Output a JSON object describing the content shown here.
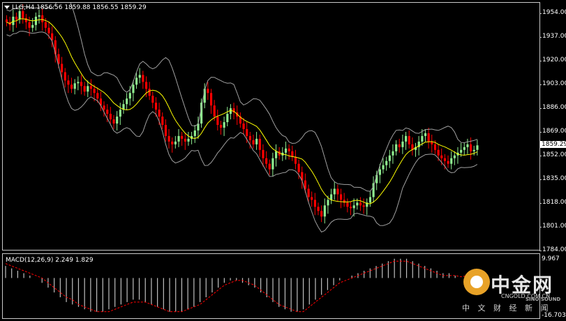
{
  "header": {
    "symbol_tf": "LLG,H4",
    "ohlc": "1856.56 1859.88 1856.55 1859.29"
  },
  "price_axis": {
    "ticks": [
      "1954.00",
      "1937.00",
      "1920.00",
      "1903.00",
      "1886.00",
      "1869.00",
      "1852.00",
      "1835.00",
      "1818.00",
      "1801.00",
      "1784.00"
    ],
    "current_price": "1859.29"
  },
  "macd": {
    "label": "MACD(12,26,9) 2.249 1.829",
    "top_value": "9.967",
    "bottom_value": "-16.703"
  },
  "watermark": {
    "brand": "中金网",
    "url": "CNGOLD.COM.CN",
    "sub": "中 文 财 经 新 闻",
    "sino": "SINO SOUND"
  },
  "colors": {
    "bull": "#90ee90",
    "bear": "#ff0000",
    "ma": "#ffff00",
    "bands": "#a0a0a0",
    "signal": "#ff0000",
    "hist": "#c0c0c0"
  },
  "chart_data": {
    "type": "candlestick",
    "title": "LLG,H4",
    "ylim": [
      1784,
      1962
    ],
    "closes": [
      1948,
      1946,
      1952,
      1950,
      1956,
      1951,
      1948,
      1944,
      1946,
      1952,
      1953,
      1948,
      1944,
      1940,
      1935,
      1925,
      1918,
      1912,
      1906,
      1903,
      1900,
      1904,
      1905,
      1902,
      1898,
      1902,
      1900,
      1897,
      1893,
      1888,
      1885,
      1882,
      1878,
      1875,
      1880,
      1885,
      1889,
      1893,
      1897,
      1903,
      1908,
      1910,
      1905,
      1900,
      1895,
      1890,
      1885,
      1880,
      1874,
      1866,
      1862,
      1860,
      1862,
      1866,
      1864,
      1862,
      1864,
      1866,
      1870,
      1875,
      1890,
      1900,
      1897,
      1888,
      1880,
      1874,
      1872,
      1876,
      1882,
      1886,
      1883,
      1880,
      1875,
      1871,
      1866,
      1863,
      1860,
      1864,
      1856,
      1850,
      1846,
      1842,
      1850,
      1855,
      1852,
      1854,
      1857,
      1855,
      1851,
      1846,
      1840,
      1834,
      1828,
      1822,
      1820,
      1815,
      1812,
      1808,
      1816,
      1820,
      1824,
      1828,
      1824,
      1820,
      1818,
      1815,
      1814,
      1816,
      1818,
      1816,
      1815,
      1818,
      1822,
      1832,
      1838,
      1842,
      1845,
      1848,
      1852,
      1855,
      1860,
      1858,
      1862,
      1866,
      1860,
      1856,
      1858,
      1862,
      1866,
      1868,
      1862,
      1860,
      1856,
      1852,
      1850,
      1848,
      1846,
      1850,
      1852,
      1854,
      1856,
      1858,
      1860,
      1855,
      1856,
      1859.29
    ],
    "macd_line": [
      5,
      4,
      3,
      2,
      1,
      0,
      -2,
      -4,
      -6,
      -8,
      -10,
      -11,
      -12,
      -13,
      -14,
      -14,
      -14,
      -13,
      -12,
      -11,
      -10,
      -9,
      -9,
      -10,
      -11,
      -12,
      -13,
      -14,
      -14,
      -14,
      -13,
      -12,
      -10,
      -8,
      -6,
      -4,
      -2,
      -1,
      -1,
      -2,
      -3,
      -4,
      -6,
      -8,
      -10,
      -12,
      -13,
      -14,
      -14,
      -13,
      -11,
      -9,
      -7,
      -5,
      -3,
      -1,
      0,
      1,
      2,
      3,
      4,
      5,
      6,
      7,
      8,
      8,
      8,
      7,
      6,
      5,
      4,
      3,
      2,
      2,
      1,
      0,
      1,
      2.249
    ],
    "signal_line": [
      6,
      5,
      4,
      3,
      2,
      1,
      0,
      -2,
      -4,
      -6,
      -8,
      -9,
      -11,
      -12,
      -13,
      -14,
      -14,
      -14,
      -13,
      -12,
      -11,
      -10,
      -10,
      -10,
      -11,
      -12,
      -13,
      -14,
      -14,
      -14,
      -13,
      -12,
      -11,
      -9,
      -7,
      -5,
      -3,
      -2,
      -1,
      -1,
      -2,
      -3,
      -5,
      -7,
      -9,
      -11,
      -12,
      -13,
      -14,
      -14,
      -12,
      -10,
      -8,
      -6,
      -4,
      -2,
      -1,
      0,
      1,
      2,
      3,
      4,
      5,
      6,
      7,
      7,
      7,
      6,
      5,
      4,
      3,
      2,
      1,
      1,
      1,
      0.5,
      1,
      1.829
    ]
  }
}
